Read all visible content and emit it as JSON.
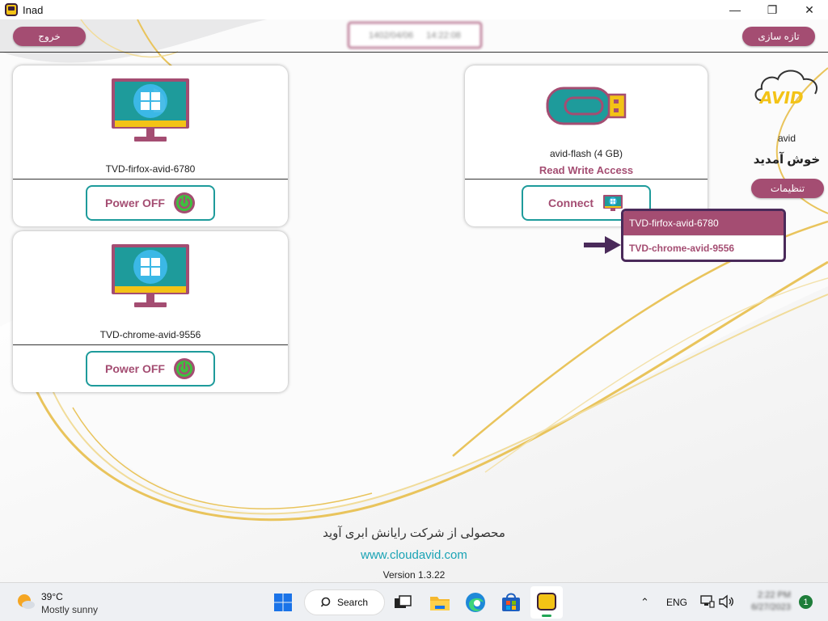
{
  "window": {
    "title": "Inad"
  },
  "header": {
    "exit_label": "خروج",
    "refresh_label": "تازه سازی",
    "date_text": "1402/04/06",
    "time_text": "14:22:08"
  },
  "vms": [
    {
      "name": "TVD-firfox-avid-6780",
      "action_label": "Power OFF"
    },
    {
      "name": "TVD-chrome-avid-9556",
      "action_label": "Power OFF"
    }
  ],
  "flash": {
    "name_line": "avid-flash  (4 GB)",
    "access_label": "Read Write Access",
    "connect_label": "Connect",
    "dropdown_items": [
      "TVD-firfox-avid-6780",
      "TVD-chrome-avid-9556"
    ]
  },
  "sidebar": {
    "logo_text": "AVID",
    "user_name": "avid",
    "welcome": "خوش آمدید",
    "settings_label": "تنظیمات"
  },
  "footer": {
    "company": "محصولی از شرکت رایانش ابری آوید",
    "url": "www.cloudavid.com",
    "version": "Version 1.3.22"
  },
  "taskbar": {
    "weather_temp": "39°C",
    "weather_desc": "Mostly sunny",
    "search_label": "Search",
    "language": "ENG",
    "clock_time": "2:22 PM",
    "clock_date": "6/27/2023",
    "notification_count": "1"
  },
  "colors": {
    "accent": "#a44d72",
    "teal": "#1e9b9b",
    "gold": "#e9c45c"
  }
}
